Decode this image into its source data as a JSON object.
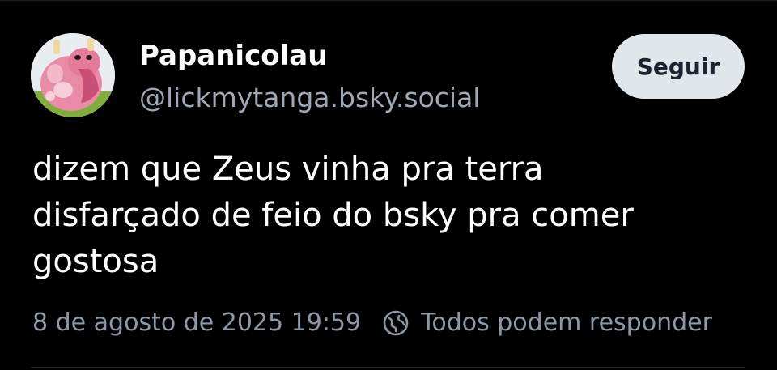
{
  "author": {
    "display_name": "Papanicolau",
    "handle": "@lickmytanga.bsky.social",
    "avatar_icon": "pink-pokemon-avatar"
  },
  "follow_button": {
    "label": "Seguir"
  },
  "post": {
    "text": "dizem que Zeus vinha pra terra\ndisfarçado de feio do bsky pra comer\ngostosa",
    "timestamp": "8 de agosto de 2025 19:59",
    "reply_setting": "Todos podem responder",
    "reply_setting_icon": "globe-earth-icon"
  },
  "colors": {
    "background": "#000000",
    "text_primary": "#ffffff",
    "text_secondary": "#9ea9b5",
    "button_bg": "#e1e6eb",
    "button_text": "#1b2430"
  }
}
